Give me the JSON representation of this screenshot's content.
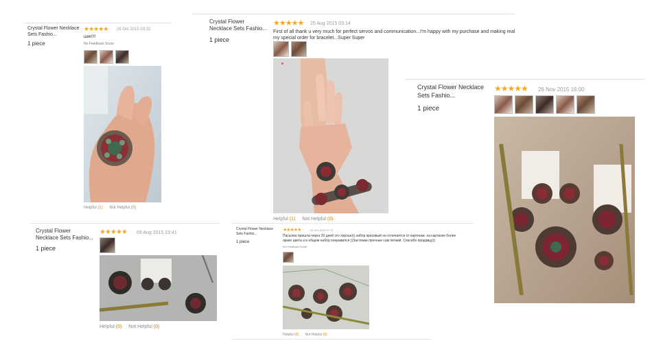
{
  "reviews": [
    {
      "product": "Crystal Flower Necklace Sets Fashio...",
      "qty": "1 piece",
      "stars": "★★★★★",
      "date": "26 Oct 2015 03:32",
      "text": "шик!!!!",
      "feedback": "No Feedback Score",
      "helpful_label": "Helpful",
      "helpful_count": "(1)",
      "not_helpful_label": "Not Helpful",
      "not_helpful_count": "(0)"
    },
    {
      "product": "Crystal Flower Necklace Sets Fashio...",
      "qty": "1 piece",
      "stars": "★★★★★",
      "date": "25 Aug 2015 03:14",
      "text": "First of all thank u very much for perfect servos and communication...I'm happy with my purchase and making real my special order for bracelet...Super Super",
      "helpful_label": "Helpful",
      "helpful_count": "(1)",
      "not_helpful_label": "Not Helpful",
      "not_helpful_count": "(0)"
    },
    {
      "product": "Crystal Flower Necklace Sets Fashio...",
      "qty": "1 piece",
      "stars": "★★★★★",
      "date": "26 Nov 2015 16:00"
    },
    {
      "product": "Crystal Flower Necklace Sets Fashio...",
      "qty": "1 piece",
      "stars": "★★★★★",
      "date": "09 Aug 2015 23:41",
      "helpful_label": "Helpful",
      "helpful_count": "(0)",
      "not_helpful_label": "Not Helpful",
      "not_helpful_count": "(0)"
    },
    {
      "product": "Crystal Flower Necklace Sets Fashio...",
      "qty": "1 piece",
      "stars": "★★★★★",
      "date": "04 Dec 2015 07:37",
      "text": "Пасылка пришла через 20 дней это хорошо)) набор красивый но отличается от картинки. на картинке более яркие цвета а в общем набор понравился ))Застежки прочные сам пепкий. Спасибо продавцу))",
      "feedback": "No Feedback Score",
      "helpful_label": "Helpful",
      "helpful_count": "(0)",
      "not_helpful_label": "Not Helpful",
      "not_helpful_count": "(0)"
    }
  ],
  "colors": {
    "star": "#f5a623",
    "count": "#e27c00",
    "link": "#888888"
  }
}
